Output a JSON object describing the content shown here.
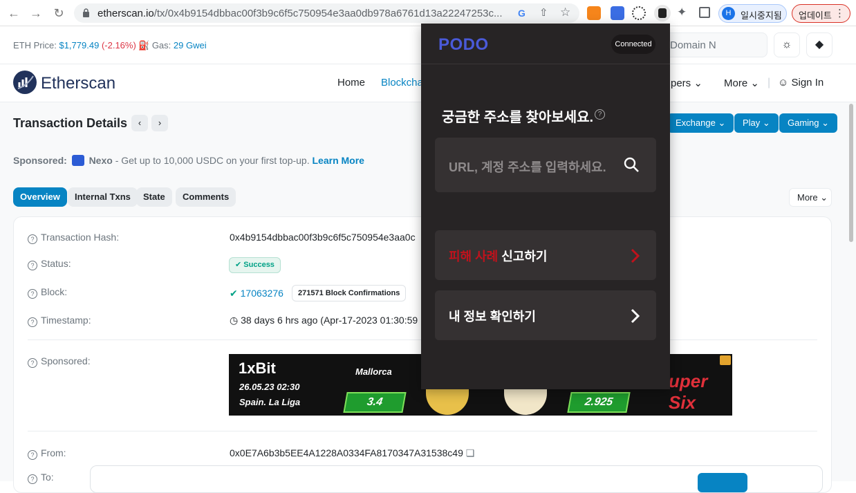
{
  "browser": {
    "url_host": "etherscan.io",
    "url_path": "/tx/0x4b9154dbbac00f3b9c6f5c750954e3aa0db978a6761d13a22247253c...",
    "profile_initial": "H",
    "profile_label": "일시중지됨",
    "update_label": "업데이트"
  },
  "topbar": {
    "eth_price_label": "ETH Price:",
    "eth_price": "$1,779.49",
    "eth_change": "(-2.16%)",
    "gas_label": "Gas:",
    "gas_value": "29 Gwei",
    "search_placeholder": "Domain N"
  },
  "header": {
    "logo_text": "Etherscan",
    "nav": {
      "home": "Home",
      "blockchain": "Blockcha",
      "developers": "pers",
      "more": "More",
      "sign_in": "Sign In"
    }
  },
  "page": {
    "title": "Transaction Details",
    "buttons": {
      "exchange": "Exchange",
      "play": "Play",
      "gaming": "Gaming"
    },
    "sponsored": {
      "label": "Sponsored:",
      "brand": "Nexo",
      "text": "- Get up to 10,000 USDC on your first top-up.",
      "link": "Learn More"
    },
    "tabs": [
      "Overview",
      "Internal Txns",
      "State",
      "Comments"
    ],
    "more_label": "More",
    "rows": {
      "hash_label": "Transaction Hash:",
      "hash_value": "0x4b9154dbbac00f3b9c6f5c750954e3aa0c",
      "status_label": "Status:",
      "status_value": "Success",
      "block_label": "Block:",
      "block_value": "17063276",
      "block_confirmations": "271571 Block Confirmations",
      "timestamp_label": "Timestamp:",
      "timestamp_value": "38 days 6 hrs ago (Apr-17-2023 01:30:59",
      "sponsored_label": "Sponsored:",
      "from_label": "From:",
      "from_value": "0x0E7A6b3b5EE4A1228A0334FA8170347A31538c49",
      "to_label": "To:"
    },
    "banner": {
      "brand": "1xBit",
      "date": "26.05.23 02:30",
      "league": "Spain. La Liga",
      "team": "Mallorca",
      "odds_1": "3.4",
      "odds_2": "2.925",
      "promo": "uper Six"
    }
  },
  "popup": {
    "brand": "PODO",
    "status": "Connected",
    "heading": "궁금한 주소를 찾아보세요.",
    "search_placeholder": "URL, 계정 주소를 입력하세요.",
    "report_red": "피해 사례",
    "report_rest": " 신고하기",
    "my_info": "내 정보 확인하기"
  }
}
